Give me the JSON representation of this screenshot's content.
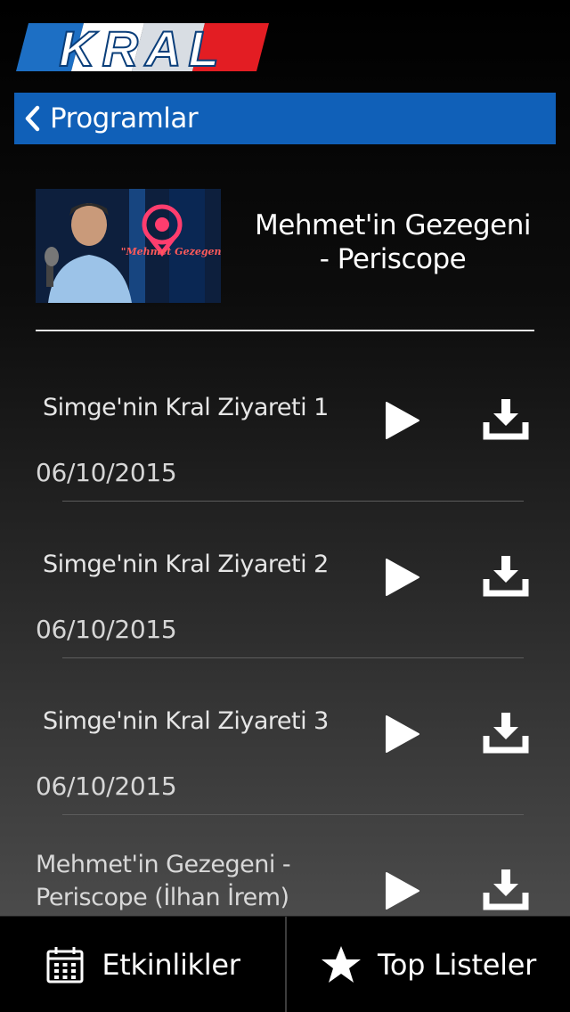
{
  "logo": {
    "text": "KRAL"
  },
  "navbar": {
    "title": "Programlar"
  },
  "program": {
    "title": "Mehmet'in Gezegeni - Periscope",
    "thumbnail_caption": "\"Mehmet Gezegen\""
  },
  "episodes": [
    {
      "title": "Simge'nin Kral Ziyareti 1",
      "date": "06/10/2015"
    },
    {
      "title": "Simge'nin Kral Ziyareti 2",
      "date": "06/10/2015"
    },
    {
      "title": "Simge'nin Kral Ziyareti 3",
      "date": "06/10/2015"
    },
    {
      "title": "Mehmet'in Gezegeni - Periscope (İlhan İrem)",
      "date": ""
    }
  ],
  "tabbar": {
    "items": [
      {
        "label": "Etkinlikler",
        "icon": "calendar-icon"
      },
      {
        "label": "Top Listeler",
        "icon": "star-icon"
      }
    ]
  },
  "colors": {
    "navbar": "#1060b8",
    "logo_red": "#e31d23",
    "logo_blue": "#1d6fc4"
  }
}
